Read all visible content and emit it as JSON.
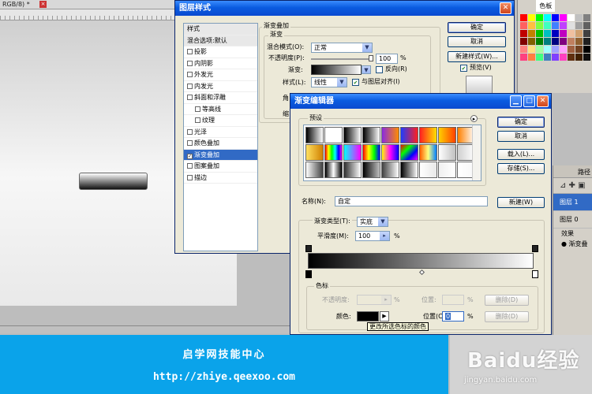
{
  "document": {
    "tab_title": "RGB/8) *",
    "close_glyph": "×"
  },
  "swatches_panel": {
    "tabs": [
      "色板"
    ],
    "colors": [
      "#ff0000",
      "#ffff00",
      "#00ff00",
      "#00ffff",
      "#0000ff",
      "#ff00ff",
      "#ffffff",
      "#c0c0c0",
      "#808080",
      "#ff6060",
      "#ffc040",
      "#80ff40",
      "#40ffc0",
      "#4080ff",
      "#c040ff",
      "#e0e0e0",
      "#a0a0a0",
      "#606060",
      "#c00000",
      "#c08000",
      "#00c000",
      "#00c0c0",
      "#0000c0",
      "#c000c0",
      "#f0c0a0",
      "#d0a070",
      "#404040",
      "#800000",
      "#806000",
      "#008000",
      "#008080",
      "#000080",
      "#800080",
      "#c08060",
      "#906030",
      "#202020",
      "#ff8080",
      "#ffe080",
      "#a0ffa0",
      "#a0ffff",
      "#a0a0ff",
      "#ffa0ff",
      "#a06040",
      "#704020",
      "#000000",
      "#ff4080",
      "#ff8040",
      "#40ff80",
      "#4080c0",
      "#8040ff",
      "#ff40c0",
      "#603010",
      "#402000",
      "#101010"
    ]
  },
  "layers_panel": {
    "tabs": "路径",
    "tools_glyphs": "⊿ ✚ ▣",
    "layers": [
      {
        "name": "图层 1",
        "selected": true
      },
      {
        "name": "图层 0",
        "selected": false
      }
    ],
    "effects_label": "效果",
    "effect_item": "渐变叠"
  },
  "layer_style": {
    "title": "图层样式",
    "list_header": "样式",
    "blend_options": "混合选项:默认",
    "items": [
      {
        "label": "投影",
        "checked": false,
        "indent": false
      },
      {
        "label": "内阴影",
        "checked": false,
        "indent": false
      },
      {
        "label": "外发光",
        "checked": false,
        "indent": false
      },
      {
        "label": "内发光",
        "checked": false,
        "indent": false
      },
      {
        "label": "斜面和浮雕",
        "checked": false,
        "indent": false
      },
      {
        "label": "等高线",
        "checked": false,
        "indent": true
      },
      {
        "label": "纹理",
        "checked": false,
        "indent": true
      },
      {
        "label": "光泽",
        "checked": false,
        "indent": false
      },
      {
        "label": "颜色叠加",
        "checked": false,
        "indent": false
      },
      {
        "label": "渐变叠加",
        "checked": true,
        "indent": false
      },
      {
        "label": "图案叠加",
        "checked": false,
        "indent": false
      },
      {
        "label": "描边",
        "checked": false,
        "indent": false
      }
    ],
    "section_title": "渐变叠加",
    "group_title": "渐变",
    "blend_mode_label": "混合模式(O):",
    "blend_mode_value": "正常",
    "opacity_label": "不透明度(P):",
    "opacity_value": "100",
    "percent": "%",
    "gradient_label": "渐变:",
    "reverse_label": "反向(R)",
    "style_label": "样式(L):",
    "style_value": "线性",
    "align_label": "与图层对齐(I)",
    "angle_label": "角",
    "scale_label": "缩",
    "ok": "确定",
    "cancel": "取消",
    "new_style": "新建样式(W)...",
    "preview_label": "预览(V)"
  },
  "gradient_editor": {
    "title": "渐变编辑器",
    "presets_label": "预设",
    "preset_arrow": "▸",
    "presets": [
      "linear-gradient(90deg,#000,#fff)",
      "linear-gradient(90deg,#fff,rgba(255,255,255,0))",
      "linear-gradient(90deg,#000,rgba(0,0,0,0))",
      "linear-gradient(90deg,#000,#fff)",
      "linear-gradient(90deg,#8a2be2,#ff8c00)",
      "linear-gradient(90deg,#1e3cff,#ff2020)",
      "linear-gradient(90deg,#ff2020,#ffe000)",
      "linear-gradient(90deg,#ffd000,#ff4000)",
      "linear-gradient(90deg,#ff8000,#ffffff)",
      "linear-gradient(90deg,#ffe060,#d08000)",
      "linear-gradient(90deg,#ff0000,#ffff00,#00ff00,#00ffff,#0000ff,#ff00ff)",
      "linear-gradient(90deg,#00ffff,#ff00ff)",
      "linear-gradient(90deg,#ff0000,#ffff00,#00ff00,#0000ff)",
      "linear-gradient(90deg,#ffff00,#ff00ff,#0000ff)",
      "linear-gradient(135deg,#ff0000,#00ff00,#0000ff,#ff00ff)",
      "linear-gradient(90deg,#ff6000,#ffff80,#0080ff)",
      "linear-gradient(90deg,#ffffff,#c0c0c0)",
      "linear-gradient(90deg,#d0d0d0,#ffffff)",
      "linear-gradient(90deg,#ffffff,#404040)",
      "linear-gradient(90deg,#000000,#ffffff,#000000)",
      "linear-gradient(90deg,#303030,#ffffff)",
      "linear-gradient(90deg,#000000,#c0c0c0)",
      "linear-gradient(90deg,#404040,#ffffff)",
      "linear-gradient(90deg,#000000,#808080,#ffffff)",
      "linear-gradient(90deg,#ffffff,#e8e8e8)",
      "linear-gradient(90deg,#f0f0f0,#ffffff)",
      "linear-gradient(90deg,#ffffff,#f8f8f8)"
    ],
    "ok": "确定",
    "cancel": "取消",
    "load": "载入(L)...",
    "save": "存储(S)...",
    "name_label": "名称(N):",
    "name_value": "自定",
    "new": "新建(W)",
    "type_label": "渐变类型(T):",
    "type_value": "实底",
    "smooth_label": "平滑度(M):",
    "smooth_value": "100",
    "percent": "%",
    "stops_title": "色标",
    "opacity_label": "不透明度:",
    "location_label": "位置:",
    "delete_d": "删除(D)",
    "color_label": "颜色:",
    "location_c_label": "位置(C):",
    "location_c_value": "0",
    "delete_c": "删除(D)",
    "tooltip": "更改所选色标的颜色"
  },
  "banner": {
    "title": "启学网技能中心",
    "url": "http://zhiye.qeexoo.com"
  },
  "watermark": {
    "logo": "Baidu经验",
    "url": "jingyan.baidu.com"
  },
  "colors": {
    "xp_blue": "#0a5ce0",
    "banner": "#0aa3ea",
    "selection": "#316ac5"
  }
}
